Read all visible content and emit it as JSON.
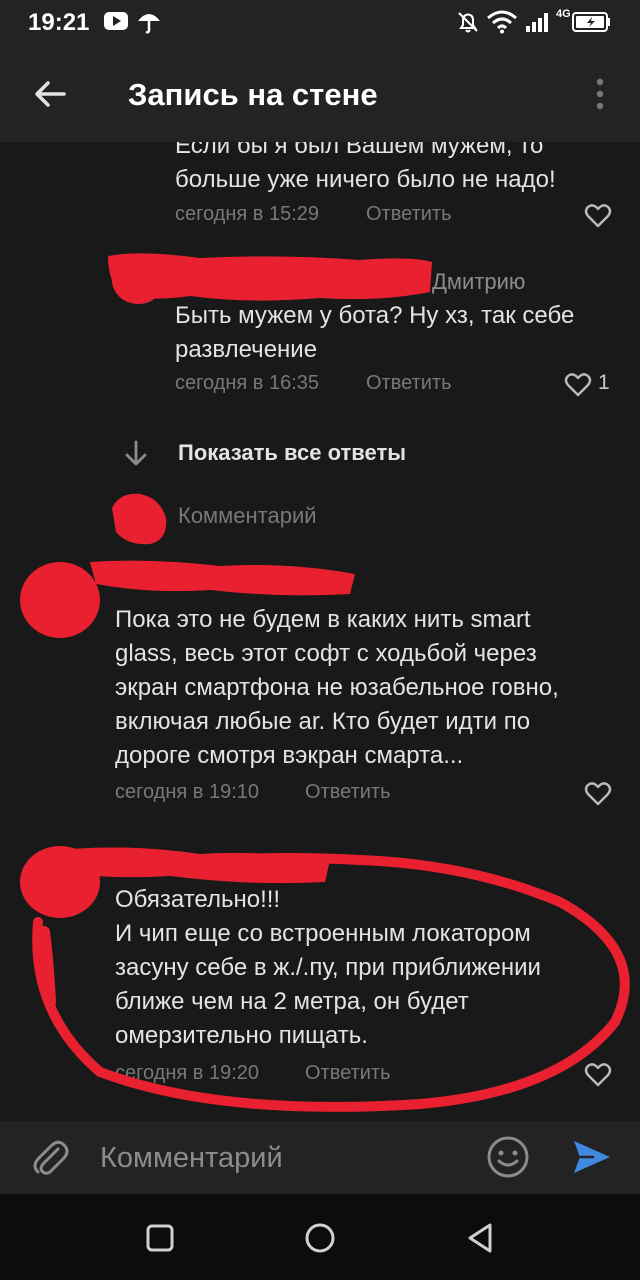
{
  "status_bar": {
    "time": "19:21",
    "network": "4G"
  },
  "header": {
    "title": "Запись на стене"
  },
  "comments": [
    {
      "text_lines": [
        "Если бы я был Вашем мужем, то",
        "больше уже ничего было не надо!"
      ],
      "time": "сегодня в 15:29",
      "reply_label": "Ответить",
      "likes": ""
    },
    {
      "author_suffix": "Дмитрию",
      "text_lines": [
        "Быть мужем у бота? Ну хз, так себе",
        "развлечение"
      ],
      "time": "сегодня в 16:35",
      "reply_label": "Ответить",
      "likes": "1"
    },
    {
      "text_lines": [
        "Пока это не будем в каких нить smart",
        "glass, весь этот софт с ходьбой через",
        "экран смартфона не юзабельное говно,",
        "включая любые ar. Кто будет идти по",
        "дороге смотря вэкран смарта..."
      ],
      "time": "сегодня в 19:10",
      "reply_label": "Ответить",
      "likes": ""
    },
    {
      "text_lines": [
        "Обязательно!!!",
        "И чип еще со встроенным локатором",
        "засуну себе в ж./.пу, при приближении",
        "ближе чем на 2 метра, он будет",
        "омерзительно пищать."
      ],
      "time": "сегодня в 19:20",
      "reply_label": "Ответить",
      "likes": ""
    }
  ],
  "thread": {
    "show_all_label": "Показать все ответы",
    "reply_placeholder": "Комментарий"
  },
  "composer": {
    "placeholder": "Комментарий"
  },
  "colors": {
    "background": "#191919",
    "bar": "#232323",
    "accent": "#3f8ae0",
    "muted": "#76787a",
    "scribble": "#e8202f"
  },
  "icons": [
    "arrow-left-icon",
    "more-vertical-icon",
    "heart-icon",
    "arrow-down-icon",
    "paperclip-icon",
    "emoji-icon",
    "send-icon",
    "nav-square-icon",
    "nav-circle-icon",
    "nav-back-icon"
  ]
}
